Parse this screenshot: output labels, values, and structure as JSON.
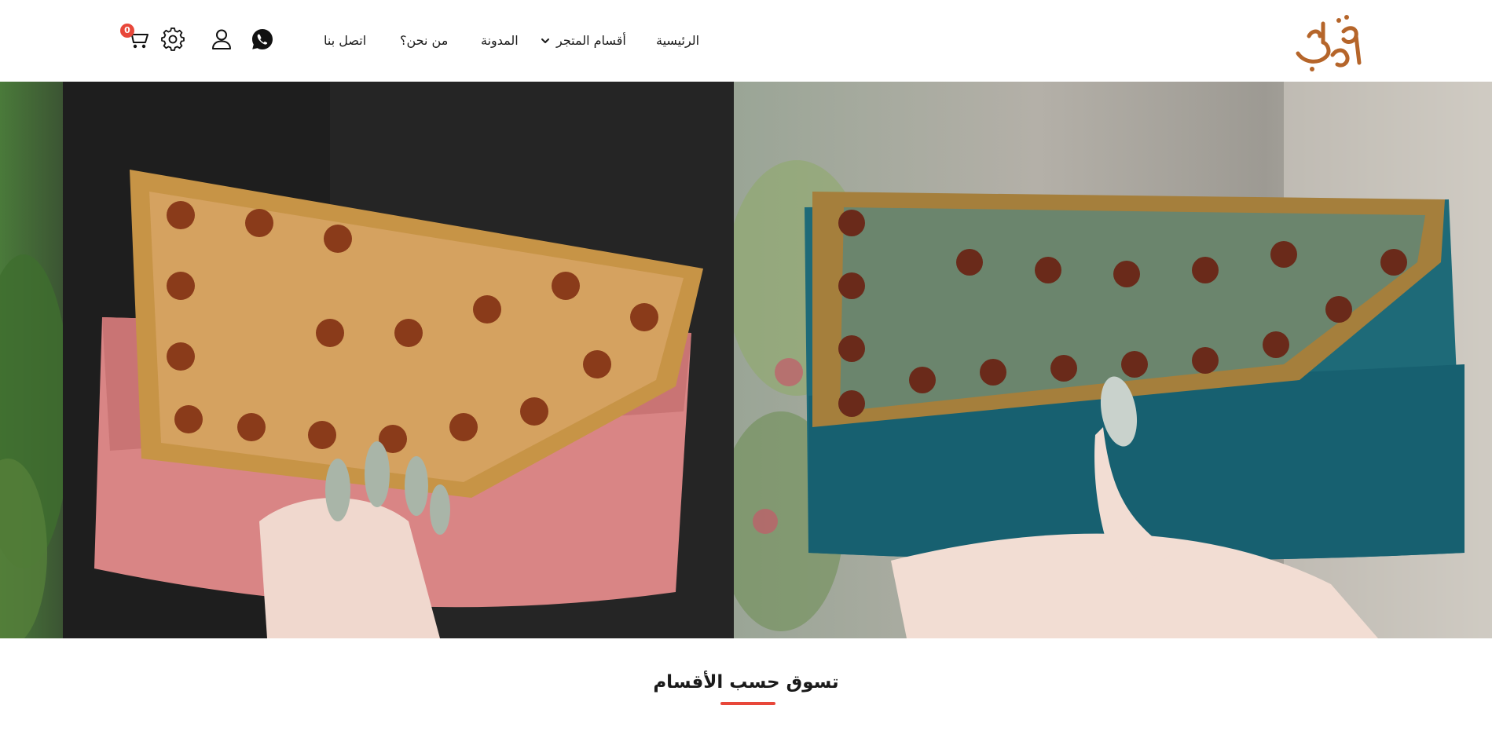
{
  "header": {
    "logo_text": "بلورغد",
    "nav": {
      "home": "الرئيسية",
      "shop_categories": "أقسام المتجر",
      "blog": "المدونة",
      "about": "من نحن؟",
      "contact": "اتصل بنا"
    },
    "cart_count": "0",
    "icons": [
      "whatsapp-icon",
      "user-icon",
      "gear-icon",
      "cart-icon",
      "chevron-down-icon"
    ]
  },
  "hero": {
    "slides": [
      "pink-clutch-image",
      "teal-clutch-image"
    ]
  },
  "section": {
    "title": "تسوق حسب الأقسام"
  },
  "colors": {
    "accent": "#e8473a",
    "logo": "#b5652a",
    "text": "#1a1a1a"
  }
}
